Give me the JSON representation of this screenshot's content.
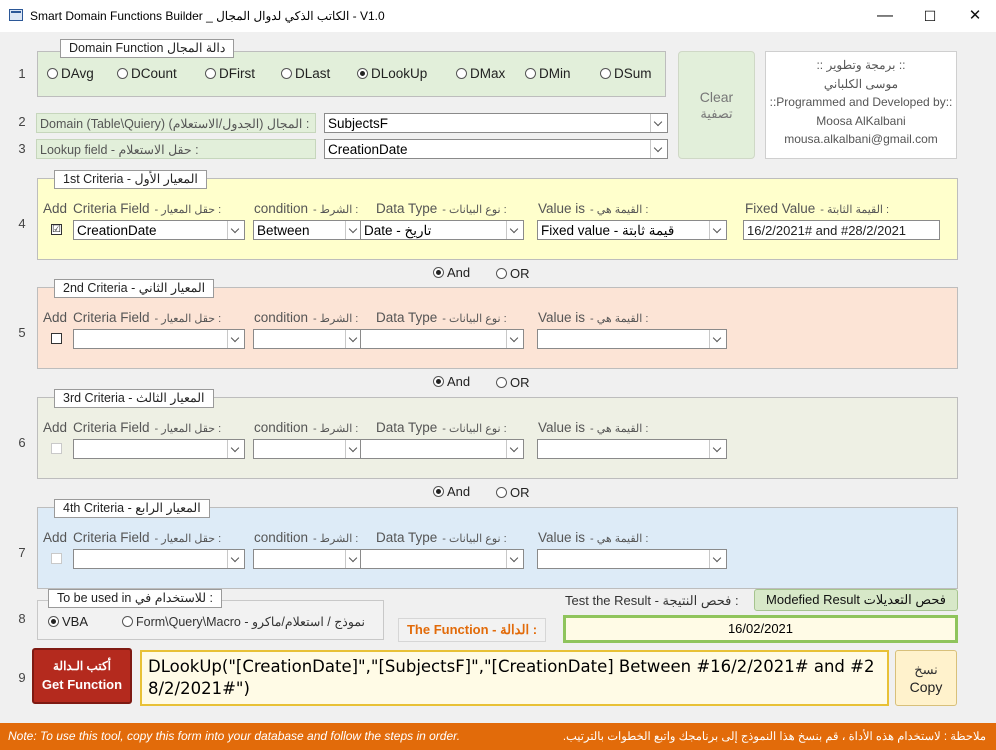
{
  "window": {
    "title": "Smart Domain Functions Builder _ الكاتب الذكي لدوال المجال  -  V1.0",
    "minimize": "—",
    "maximize": "☐",
    "close": "✕"
  },
  "domain_function": {
    "legend": "Domain Function  دالة المجال",
    "row": "1",
    "options": [
      "DAvg",
      "DCount",
      "DFirst",
      "DLast",
      "DLookUp",
      "DMax",
      "DMin",
      "DSum"
    ],
    "selected": "DLookUp"
  },
  "clear_button": {
    "en": "Clear",
    "ar": "تصفية"
  },
  "credits": {
    "line1": ":: برمجة وتطوير ::",
    "line2": "موسى الكلباني",
    "line3": "::Programmed and Developed by::",
    "line4": "Moosa AlKalbani",
    "line5": "mousa.alkalbani@gmail.com"
  },
  "domain_row": {
    "row": "2",
    "label": "Domain (Table\\Quiery) (المجال (الجدول/الاستعلام :",
    "value": "SubjectsF"
  },
  "lookup_row": {
    "row": "3",
    "label": "Lookup field  -  حقل الاستعلام :",
    "value": "CreationDate"
  },
  "headers": {
    "add": "Add",
    "field": "Criteria Field",
    "field_ar": "- حقل المعيار :",
    "condition": "condition",
    "condition_ar": "- الشرط :",
    "datatype": "Data Type",
    "datatype_ar": "- نوع البيانات :",
    "valueis": "Value is",
    "valueis_ar": "- القيمة هي :",
    "fixed": "Fixed Value",
    "fixed_ar": "- القيمة الثابتة :"
  },
  "criteria": [
    {
      "row": "4",
      "legend": "1st Criteria  -  المعيار الأول",
      "checked": "☑",
      "field": "CreationDate",
      "condition": "Between",
      "datatype": "Date - تاريخ",
      "valueis": "Fixed value - قيمة ثابتة",
      "fixed_value": "16/2/2021# and #28/2/2021",
      "bg": "#ffffcc"
    },
    {
      "row": "5",
      "legend": "2nd Criteria  -  المعيار الثاني",
      "checked": "",
      "field": "",
      "condition": "",
      "datatype": "",
      "valueis": "",
      "bg": "#fce4d6"
    },
    {
      "row": "6",
      "legend": "3rd Criteria  -  المعيار الثالث",
      "checked": "",
      "field": "",
      "condition": "",
      "datatype": "",
      "valueis": "",
      "bg": "#eef0e4"
    },
    {
      "row": "7",
      "legend": "4th Criteria  -  المعيار الرابع",
      "checked": "",
      "field": "",
      "condition": "",
      "datatype": "",
      "valueis": "",
      "bg": "#ddebf7"
    }
  ],
  "logic": {
    "and": "And",
    "or": "OR"
  },
  "usage": {
    "row": "8",
    "legend": "To be used in  للاستخدام في :",
    "vba": "VBA",
    "form": "Form\\Query\\Macro - نموذج / استعلام/ماكرو",
    "selected": "VBA"
  },
  "function_label": "The Function - الدالة :",
  "test": {
    "label": "Test the Result  -  فحص النتيجة :",
    "button": "Modefied Result فحص التعديلات",
    "result": "16/02/2021"
  },
  "get_function": {
    "row": "9",
    "ar": "أكتب الـدالة",
    "en": "Get Function"
  },
  "function_text": "DLookUp(\"[CreationDate]\",\"[SubjectsF]\",\"[CreationDate] Between #16/2/2021# and #28/2/2021#\")",
  "copy_button": {
    "ar": "نسخ",
    "en": "Copy"
  },
  "footer": {
    "note_en": "Note: To use this tool, copy this form into your database and follow the steps in order.",
    "note_ar": "ملاحظة : لاستخدام هذه الأداة ، قم بنسخ هذا النموذج إلى برنامجك واتبع الخطوات بالترتيب."
  }
}
